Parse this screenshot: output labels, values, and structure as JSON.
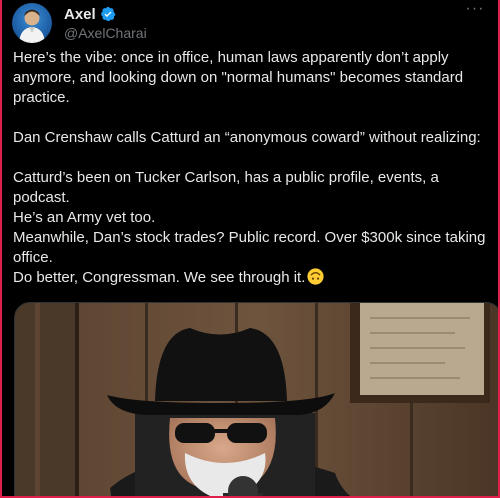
{
  "author": {
    "display_name": "Axel",
    "handle": "@AxelCharai",
    "verified": true,
    "avatar_icon": "avatar-icon"
  },
  "menu": {
    "icon": "more-dots-icon",
    "label": "···"
  },
  "tweet": {
    "paragraph_1": "Here’s the vibe: once in office, human laws apparently don’t apply anymore, and looking down on \"normal humans\" becomes standard practice.",
    "paragraph_2": "Dan Crenshaw calls Catturd an “anonymous coward” without realizing:",
    "line_3": "Catturd’s been on Tucker Carlson, has a public profile, events, a podcast.",
    "line_4": "He’s an Army vet too.",
    "line_5": "Meanwhile, Dan’s stock trades? Public record. Over $300k since taking office.",
    "line_6": "Do better, Congressman. We see through it.",
    "emoji_icon": "upside-down-face-emoji-icon"
  },
  "media": {
    "kind": "video-still",
    "subject": "man-in-black-cowboy-hat-and-sunglasses-icon"
  },
  "colors": {
    "background": "#000000",
    "text": "#e7e9ea",
    "secondary_text": "#71767b",
    "verified_badge": "#1d9bf0",
    "frame_border": "#e0204a"
  }
}
